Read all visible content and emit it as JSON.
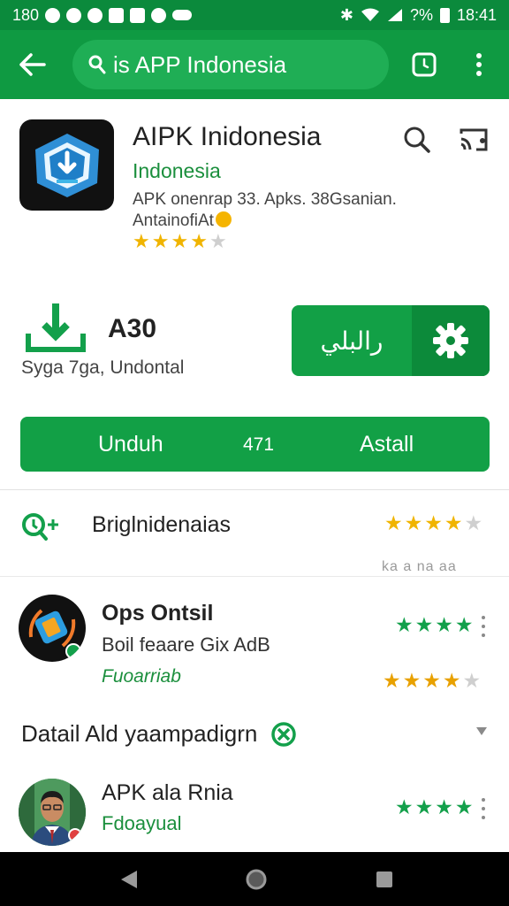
{
  "status_bar": {
    "time_left": "180",
    "battery_pct": "?%",
    "time_right": "18:41"
  },
  "toolbar": {
    "back_icon": "arrow-left-icon",
    "search_query": "is APP Indonesia"
  },
  "app": {
    "title": "AIPK Inidonesia",
    "developer": "Indonesia",
    "desc_line1": "APK onenrap 33.  Apks. 38Gsanian.",
    "desc_line2": "AntainofiAt",
    "rating_stars": 4,
    "rating_max": 5
  },
  "stats": {
    "size_value": "A30",
    "size_label": "Syga 7ga,  Undontal",
    "open_button_label": "رالبلي"
  },
  "install_bar": {
    "left": "Unduh",
    "middle": "471",
    "right": "Astall"
  },
  "review": {
    "title": "Briglnidenaias",
    "stars": 4,
    "faded_text": "ka a na aa"
  },
  "rows": [
    {
      "title": "Ops Ontsil",
      "subtitle": "Boil feaare Gix AdB",
      "green_text": "Fuoarriab",
      "green_stars": 4,
      "orange_stars": 3.5
    },
    {
      "title": "APK ala Rnia",
      "subtitle": "Fdoayual",
      "green_stars": 4
    }
  ],
  "detail": {
    "title": "Datail Ald yaampadigrn"
  },
  "colors": {
    "primary": "#0f9a42",
    "status_bar": "#0b8a3c",
    "button": "#12a046",
    "star_yellow": "#f0b400",
    "star_green": "#13a04b"
  }
}
